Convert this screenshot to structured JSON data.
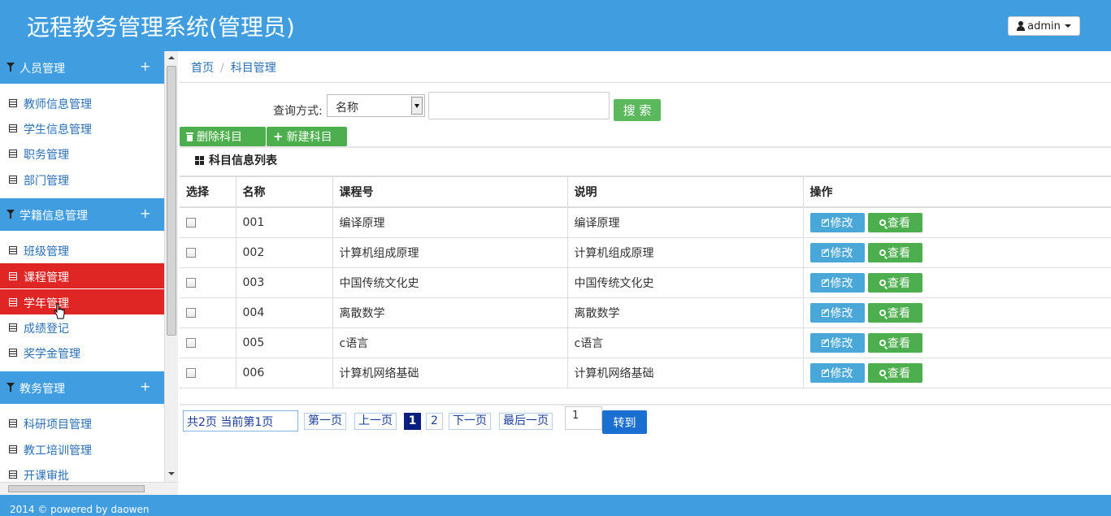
{
  "app": {
    "title": "远程教务管理系统(管理员)",
    "user_label": "admin"
  },
  "sidebar": {
    "sections": [
      {
        "label": "人员管理",
        "plus": "+",
        "items": [
          "教师信息管理",
          "学生信息管理",
          "职务管理",
          "部门管理"
        ]
      },
      {
        "label": "学籍信息管理",
        "plus": "+",
        "items": [
          "班级管理",
          "课程管理",
          "学年管理",
          "成绩登记",
          "奖学金管理"
        ]
      },
      {
        "label": "教务管理",
        "plus": "+",
        "items": [
          "科研项目管理",
          "教工培训管理",
          "开课审批"
        ]
      }
    ],
    "active_items": [
      "课程管理",
      "学年管理"
    ]
  },
  "breadcrumb": {
    "home": "首页",
    "current": "科目管理",
    "separator": "/"
  },
  "search": {
    "label": "查询方式:",
    "select_value": "名称",
    "input_value": "",
    "button": "搜 索"
  },
  "actions": {
    "delete": "删除科目",
    "create": "新建科目"
  },
  "list_title": "科目信息列表",
  "table": {
    "headers": [
      "选择",
      "名称",
      "课程号",
      "说明",
      "操作"
    ],
    "rows": [
      {
        "name": "001",
        "course": "编译原理",
        "desc": "编译原理"
      },
      {
        "name": "002",
        "course": "计算机组成原理",
        "desc": "计算机组成原理"
      },
      {
        "name": "003",
        "course": "中国传统文化史",
        "desc": "中国传统文化史"
      },
      {
        "name": "004",
        "course": "离散数学",
        "desc": "离散数学"
      },
      {
        "name": "005",
        "course": "c语言",
        "desc": "c语言"
      },
      {
        "name": "006",
        "course": "计算机网络基础",
        "desc": "计算机网络基础"
      }
    ],
    "edit_label": "修改",
    "view_label": "查看"
  },
  "pager": {
    "info": "共2页 当前第1页",
    "first": "第一页",
    "prev": "上一页",
    "current": "1",
    "page2": "2",
    "next": "下一页",
    "last": "最后一页",
    "goto_value": "1",
    "go": "转到"
  },
  "footer": "2014 © powered by daowen",
  "colors": {
    "primary": "#3f9de0",
    "active": "#e02525",
    "success": "#4cae4c",
    "info": "#4aa8d8",
    "pager_current": "#0a1f80"
  }
}
